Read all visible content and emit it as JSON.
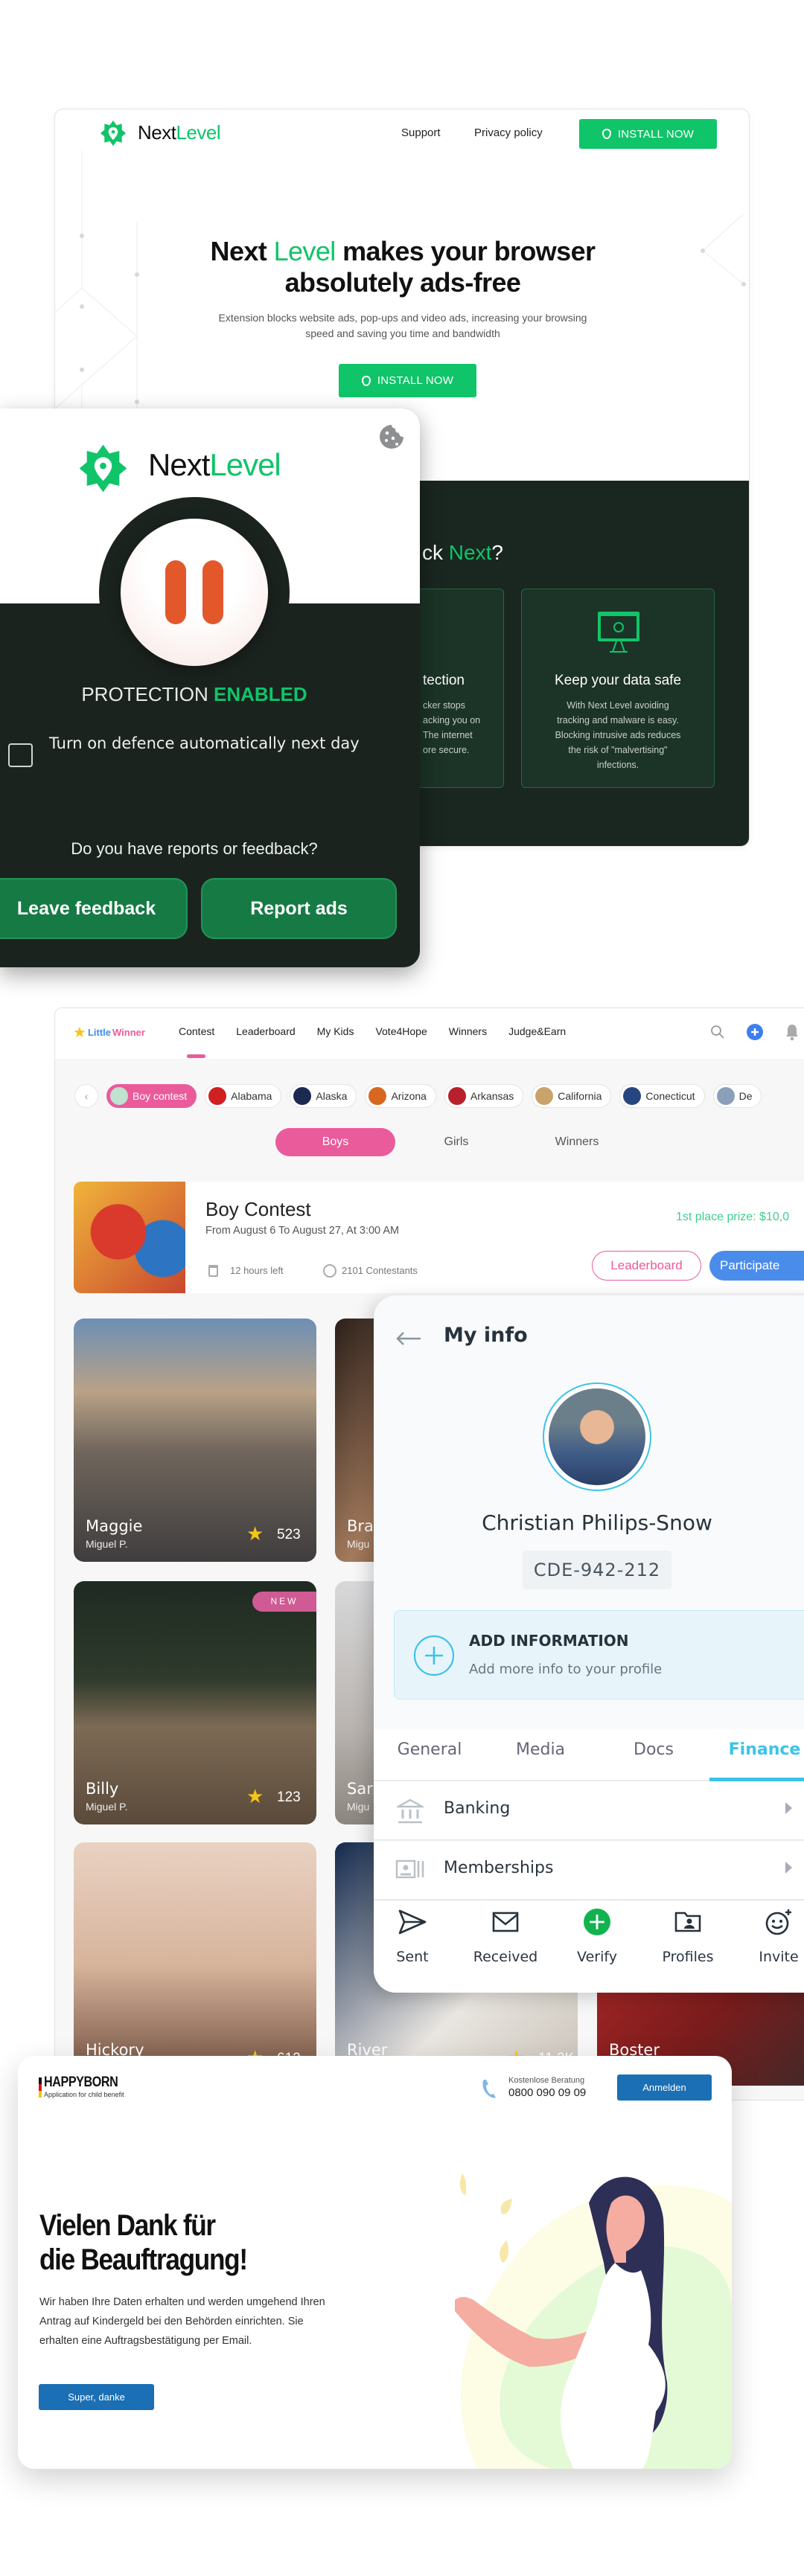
{
  "colors": {
    "nextlevel_green": "#10c469",
    "nextlevel_dark": "#1b231f",
    "pause_orange": "#e3582b",
    "littlewinner_pink": "#ea5b9b",
    "littlewinner_blue": "#4a8cea",
    "prize_green": "#3ecf8e",
    "myinfo_accent": "#3cc3e8",
    "verify_green": "#12b34f",
    "happyborn_blue": "#1a6fb5"
  },
  "nextlevel_site": {
    "brand": {
      "part1": "Next",
      "part2": "Level"
    },
    "nav": {
      "support": "Support",
      "privacy": "Privacy policy"
    },
    "install_label": "INSTALL NOW",
    "headline": {
      "pre": "Next ",
      "accent": "Level",
      "post": " makes your browser",
      "line2": "absolutely ads-free"
    },
    "subtitle": "Extension blocks website ads, pop-ups and video ads, increasing your browsing speed and saving you time and bandwidth",
    "cta_label": "INSTALL NOW",
    "why": {
      "pre": "ck ",
      "accent": "Next",
      "post": "?"
    },
    "features": [
      {
        "title": "tection",
        "lines": [
          "cker stops",
          "acking you on",
          "The internet",
          "ore secure."
        ]
      },
      {
        "title": "Keep your data safe",
        "lines": [
          "With Next Level avoiding",
          "tracking and malware is easy.",
          "Blocking intrusive ads reduces",
          "the risk of \"malvertising\"",
          "infections."
        ]
      }
    ]
  },
  "popup": {
    "brand": {
      "part1": "Next",
      "part2": "Level"
    },
    "status": {
      "label": "PROTECTION ",
      "value": "ENABLED"
    },
    "auto_defence": {
      "label": "Turn on defence automatically next day",
      "checked": false
    },
    "question": "Do you have reports or feedback?",
    "feedback_label": "Leave feedback",
    "report_label": "Report ads"
  },
  "littlewinner": {
    "brand": {
      "part1": "Little",
      "part2": "Winner"
    },
    "nav": [
      "Contest",
      "Leaderboard",
      "My Kids",
      "Vote4Hope",
      "Winners",
      "Judge&Earn"
    ],
    "active_nav": "Contest",
    "chips": [
      {
        "label": "Boy contest",
        "active": true,
        "color": "#bfe3d0"
      },
      {
        "label": "Alabama",
        "color": "#d02020"
      },
      {
        "label": "Alaska",
        "color": "#1c2a52"
      },
      {
        "label": "Arizona",
        "color": "#d8671f"
      },
      {
        "label": "Arkansas",
        "color": "#b8202c"
      },
      {
        "label": "California",
        "color": "#c9a36a"
      },
      {
        "label": "Conecticut",
        "color": "#274680"
      },
      {
        "label": "De",
        "color": "#8aa0b8"
      }
    ],
    "gender_tabs": [
      "Boys",
      "Girls",
      "Winners"
    ],
    "active_gender": "Boys",
    "contest": {
      "title": "Boy Contest",
      "dates": "From August 6 To August 27, At 3:00 AM",
      "time_left": "12 hours left",
      "contestants": "2101 Contestants",
      "prize": "1st place prize: $10,0",
      "leaderboard_label": "Leaderboard",
      "participate_label": "Participate"
    },
    "tiles": [
      {
        "name": "Maggie",
        "parent": "Miguel P.",
        "score": "523",
        "col": 0,
        "row": 0,
        "bg": "linear-gradient(180deg,#6d8fb5 0%,#b9a287 30%,#6f655c 55%,#3f3d3d 100%)"
      },
      {
        "name": "Bra",
        "parent": "Migu",
        "col": 1,
        "row": 0,
        "bg": "linear-gradient(120deg,#2a1f1a,#a37a5c 40%,#3b2a22)"
      },
      {
        "name": "Billy",
        "parent": "Miguel P.",
        "score": "123",
        "badge": "NEW",
        "col": 0,
        "row": 1,
        "bg": "linear-gradient(180deg,#1f2a22 0%,#2f3a2c 40%,#7d6a55 60%,#5a4a3a 100%)"
      },
      {
        "name": "Sar",
        "parent": "Migu",
        "col": 1,
        "row": 1,
        "bg": "linear-gradient(180deg,#d8d8da,#b9b4b0 60%,#8c857f)"
      },
      {
        "name": "Hickory",
        "score": "612",
        "col": 0,
        "row": 2,
        "bg": "linear-gradient(180deg,#e9d2c3,#d7b49c 50%,#6a4a3a)"
      },
      {
        "name": "River",
        "score": "11.2K+",
        "col": 1,
        "row": 2,
        "bg": "linear-gradient(135deg,#13294d,#e9e5e0 60%,#c9c2b8)"
      },
      {
        "name": "Boster",
        "col": 2,
        "row": 2,
        "bg": "linear-gradient(135deg,#c22b2b,#7a1c1c 60%,#3a2a2a)"
      }
    ]
  },
  "myinfo": {
    "title": "My info",
    "name": "Christian Philips-Snow",
    "id_code": "CDE-942-212",
    "add_info": {
      "title": "ADD INFORMATION",
      "subtitle": "Add more info to your profile"
    },
    "tabs": [
      "General",
      "Media",
      "Docs",
      "Finance"
    ],
    "active_tab": "Finance",
    "rows": [
      {
        "label": "Banking",
        "icon": "bank-icon"
      },
      {
        "label": "Memberships",
        "icon": "id-card-icon"
      }
    ],
    "bottom_nav": [
      {
        "label": "Sent",
        "icon": "send-icon"
      },
      {
        "label": "Received",
        "icon": "mail-icon"
      },
      {
        "label": "Verify",
        "icon": "plus-circle-icon"
      },
      {
        "label": "Profiles",
        "icon": "folder-user-icon"
      },
      {
        "label": "Invite",
        "icon": "smiley-plus-icon"
      }
    ]
  },
  "happyborn": {
    "brand": "HAPPYBORN",
    "tagline": "Application for child benefit",
    "hotline_label": "Kostenlose Beratung",
    "hotline_number": "0800 090 09 09",
    "login_label": "Anmelden",
    "headline_line1": "Vielen Dank für",
    "headline_line2": "die Beauftragung!",
    "body": "Wir haben Ihre Daten erhalten und werden umgehend Ihren Antrag auf Kindergeld bei den Behörden einrichten. Sie erhalten eine Auftragsbestätigung per Email.",
    "confirm_label": "Super, danke"
  }
}
